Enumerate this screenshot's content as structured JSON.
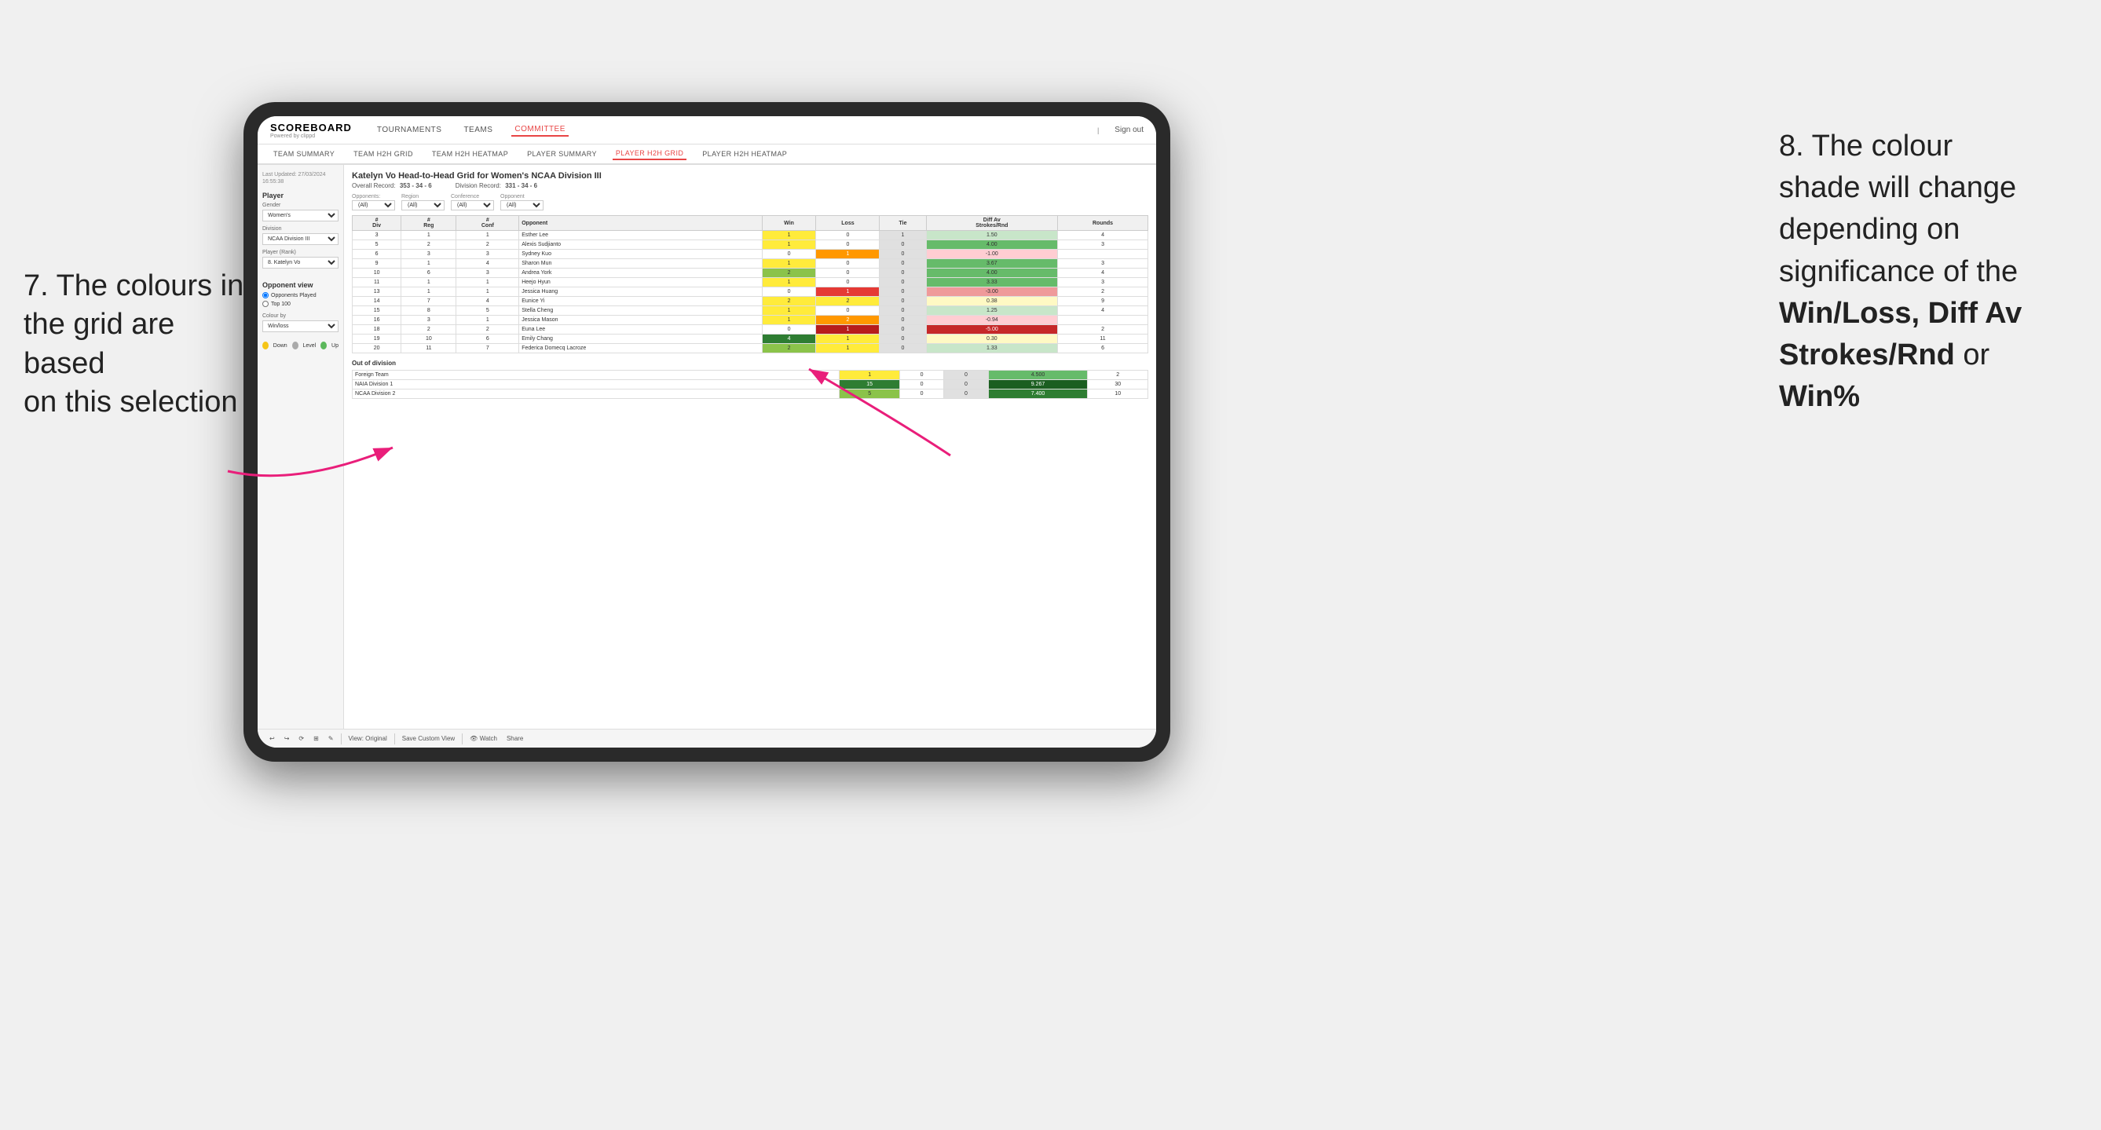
{
  "annotations": {
    "left": {
      "line1": "7. The colours in",
      "line2": "the grid are based",
      "line3": "on this selection"
    },
    "right": {
      "line1": "8. The colour",
      "line2": "shade will change",
      "line3": "depending on",
      "line4": "significance of the",
      "bold1": "Win/Loss, Diff Av",
      "bold2": "Strokes/Rnd",
      "line5": " or",
      "bold3": "Win%"
    }
  },
  "nav": {
    "logo": "SCOREBOARD",
    "logo_sub": "Powered by clippd",
    "items": [
      "TOURNAMENTS",
      "TEAMS",
      "COMMITTEE"
    ],
    "active": "COMMITTEE",
    "sign_out": "Sign out"
  },
  "sub_nav": {
    "items": [
      "TEAM SUMMARY",
      "TEAM H2H GRID",
      "TEAM H2H HEATMAP",
      "PLAYER SUMMARY",
      "PLAYER H2H GRID",
      "PLAYER H2H HEATMAP"
    ],
    "active": "PLAYER H2H GRID"
  },
  "sidebar": {
    "timestamp": "Last Updated: 27/03/2024\n16:55:38",
    "player_section": "Player",
    "gender_label": "Gender",
    "gender_value": "Women's",
    "division_label": "Division",
    "division_value": "NCAA Division III",
    "player_rank_label": "Player (Rank)",
    "player_rank_value": "8. Katelyn Vo",
    "opponent_view_label": "Opponent view",
    "opponent_view_options": [
      "Opponents Played",
      "Top 100"
    ],
    "opponent_view_selected": "Opponents Played",
    "colour_by_label": "Colour by",
    "colour_by_value": "Win/loss",
    "legend": [
      {
        "color": "#f5c518",
        "label": "Down"
      },
      {
        "color": "#aaaaaa",
        "label": "Level"
      },
      {
        "color": "#5cb85c",
        "label": "Up"
      }
    ]
  },
  "grid": {
    "title": "Katelyn Vo Head-to-Head Grid for Women's NCAA Division III",
    "overall_record_label": "Overall Record:",
    "overall_record": "353 - 34 - 6",
    "division_record_label": "Division Record:",
    "division_record": "331 - 34 - 6",
    "filters": {
      "opponents_label": "Opponents:",
      "opponents_value": "(All)",
      "region_label": "Region",
      "region_value": "(All)",
      "conference_label": "Conference",
      "conference_value": "(All)",
      "opponent_label": "Opponent",
      "opponent_value": "(All)"
    },
    "table_headers": {
      "div": "#\nDiv",
      "reg": "#\nReg",
      "conf": "#\nConf",
      "opponent": "Opponent",
      "win": "Win",
      "loss": "Loss",
      "tie": "Tie",
      "diff_av": "Diff Av\nStrokes/Rnd",
      "rounds": "Rounds"
    },
    "rows": [
      {
        "div": 3,
        "reg": 1,
        "conf": 1,
        "name": "Esther Lee",
        "win": 1,
        "loss": 0,
        "tie": 1,
        "diff": 1.5,
        "rounds": 4,
        "win_color": "yellow",
        "loss_color": "white",
        "diff_color": "light-green"
      },
      {
        "div": 5,
        "reg": 2,
        "conf": 2,
        "name": "Alexis Sudjianto",
        "win": 1,
        "loss": 0,
        "tie": 0,
        "diff": 4.0,
        "rounds": 3,
        "win_color": "yellow",
        "loss_color": "white",
        "diff_color": "green"
      },
      {
        "div": 6,
        "reg": 3,
        "conf": 3,
        "name": "Sydney Kuo",
        "win": 0,
        "loss": 1,
        "tie": 0,
        "diff": -1.0,
        "rounds": "",
        "win_color": "white",
        "loss_color": "orange",
        "diff_color": "light-red"
      },
      {
        "div": 9,
        "reg": 1,
        "conf": 4,
        "name": "Sharon Mun",
        "win": 1,
        "loss": 0,
        "tie": 0,
        "diff": 3.67,
        "rounds": 3,
        "win_color": "yellow",
        "loss_color": "white",
        "diff_color": "green"
      },
      {
        "div": 10,
        "reg": 6,
        "conf": 3,
        "name": "Andrea York",
        "win": 2,
        "loss": 0,
        "tie": 0,
        "diff": 4.0,
        "rounds": 4,
        "win_color": "green",
        "loss_color": "white",
        "diff_color": "green"
      },
      {
        "div": 11,
        "reg": 1,
        "conf": 1,
        "name": "Heejo Hyun",
        "win": 1,
        "loss": 0,
        "tie": 0,
        "diff": 3.33,
        "rounds": 3,
        "win_color": "yellow",
        "loss_color": "white",
        "diff_color": "green"
      },
      {
        "div": 13,
        "reg": 1,
        "conf": 1,
        "name": "Jessica Huang",
        "win": 0,
        "loss": 1,
        "tie": 0,
        "diff": -3.0,
        "rounds": 2,
        "win_color": "white",
        "loss_color": "red",
        "diff_color": "red"
      },
      {
        "div": 14,
        "reg": 7,
        "conf": 4,
        "name": "Eunice Yi",
        "win": 2,
        "loss": 2,
        "tie": 0,
        "diff": 0.38,
        "rounds": 9,
        "win_color": "yellow",
        "loss_color": "yellow",
        "diff_color": "yellow"
      },
      {
        "div": 15,
        "reg": 8,
        "conf": 5,
        "name": "Stella Cheng",
        "win": 1,
        "loss": 0,
        "tie": 0,
        "diff": 1.25,
        "rounds": 4,
        "win_color": "yellow",
        "loss_color": "white",
        "diff_color": "light-green"
      },
      {
        "div": 16,
        "reg": 3,
        "conf": 1,
        "name": "Jessica Mason",
        "win": 1,
        "loss": 2,
        "tie": 0,
        "diff": -0.94,
        "rounds": "",
        "win_color": "yellow",
        "loss_color": "orange",
        "diff_color": "light-red"
      },
      {
        "div": 18,
        "reg": 2,
        "conf": 2,
        "name": "Euna Lee",
        "win": 0,
        "loss": 1,
        "tie": 0,
        "diff": -5.0,
        "rounds": 2,
        "win_color": "white",
        "loss_color": "dark-red",
        "diff_color": "dark-red"
      },
      {
        "div": 19,
        "reg": 10,
        "conf": 6,
        "name": "Emily Chang",
        "win": 4,
        "loss": 1,
        "tie": 0,
        "diff": 0.3,
        "rounds": 11,
        "win_color": "dark-green",
        "loss_color": "yellow",
        "diff_color": "yellow"
      },
      {
        "div": 20,
        "reg": 11,
        "conf": 7,
        "name": "Federica Domecq Lacroze",
        "win": 2,
        "loss": 1,
        "tie": 0,
        "diff": 1.33,
        "rounds": 6,
        "win_color": "green",
        "loss_color": "yellow",
        "diff_color": "light-green"
      }
    ],
    "out_of_division_label": "Out of division",
    "out_of_division_rows": [
      {
        "name": "Foreign Team",
        "win": 1,
        "loss": 0,
        "tie": 0,
        "diff": 4.5,
        "rounds": 2,
        "win_color": "yellow",
        "diff_color": "green"
      },
      {
        "name": "NAIA Division 1",
        "win": 15,
        "loss": 0,
        "tie": 0,
        "diff": 9.267,
        "rounds": 30,
        "win_color": "dark-green",
        "diff_color": "dark-green"
      },
      {
        "name": "NCAA Division 2",
        "win": 5,
        "loss": 0,
        "tie": 0,
        "diff": 7.4,
        "rounds": 10,
        "win_color": "green",
        "diff_color": "dark-green"
      }
    ]
  },
  "toolbar": {
    "buttons": [
      "↩",
      "↪",
      "⟳",
      "⊞",
      "✎",
      "↺",
      "⏱"
    ],
    "view_original": "View: Original",
    "save_custom": "Save Custom View",
    "watch": "Watch",
    "share": "Share"
  }
}
